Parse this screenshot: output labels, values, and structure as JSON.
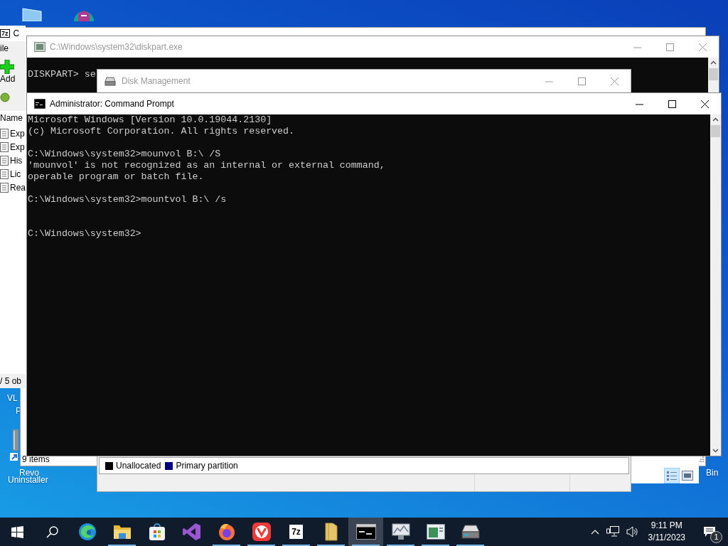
{
  "desktop_icons": [
    {
      "kind": "window"
    },
    {
      "kind": "hexagon"
    },
    {
      "lines": [
        "VL",
        "P"
      ]
    },
    {
      "kind": "shortcut",
      "lines": [
        "Revo",
        "Uninstaller"
      ]
    },
    {
      "kind": "bin",
      "lines": [
        "Bin"
      ]
    }
  ],
  "windows": [
    {
      "kind": "explorer",
      "status": "9 items"
    },
    {
      "kind": "pane",
      "views": [
        {
          "selected": true
        },
        {
          "selected": false
        }
      ]
    },
    {
      "kind": "sevenzip",
      "logo": "7z",
      "title": "C",
      "menu": "ile",
      "tool": "Add",
      "column": "Name",
      "items": [
        "Exp",
        "Exp",
        "His",
        "Lic",
        "Rea"
      ],
      "status": "/ 5 ob"
    },
    {
      "kind": "console",
      "title": "C:\\Windows\\system32\\diskpart.exe",
      "active": false,
      "output": "DISKPART> se"
    },
    {
      "kind": "diskmgmt",
      "title": "Disk Management",
      "active": false,
      "legend": [
        {
          "label": "Unallocated",
          "color": "#000000"
        },
        {
          "label": "Primary partition",
          "color": "#000080"
        }
      ]
    },
    {
      "kind": "console",
      "title": "Administrator:  Command Prompt",
      "active": true,
      "output": "Microsoft Windows [Version 10.0.19044.2130]\n(c) Microsoft Corporation. All rights reserved.\n\nC:\\Windows\\system32>mounvol B:\\ /S\n'mounvol' is not recognized as an internal or external command,\noperable program or batch file.\n\nC:\\Windows\\system32>mountvol B:\\ /s\n\n\nC:\\Windows\\system32>"
    }
  ],
  "taskbar": {
    "apps": [
      {
        "kind": "edge",
        "running": false,
        "selected": false
      },
      {
        "kind": "explorer",
        "running": true,
        "selected": false
      },
      {
        "kind": "store",
        "running": false,
        "selected": false
      },
      {
        "kind": "vs",
        "running": false,
        "selected": false
      },
      {
        "kind": "firefox",
        "running": true,
        "selected": false
      },
      {
        "kind": "vivaldi",
        "running": true,
        "selected": false
      },
      {
        "kind": "sevenzip",
        "label": "7z",
        "running": true,
        "selected": false
      },
      {
        "kind": "folder",
        "running": true,
        "selected": false
      },
      {
        "kind": "cmd",
        "running": true,
        "selected": true
      },
      {
        "kind": "perfmon",
        "running": true,
        "selected": false
      },
      {
        "kind": "window",
        "running": true,
        "selected": false
      },
      {
        "kind": "diskmgmt",
        "running": true,
        "selected": false
      }
    ],
    "time": "9:11 PM",
    "date": "3/11/2023",
    "notifications": "1"
  }
}
